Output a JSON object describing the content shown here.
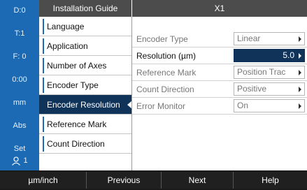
{
  "status": {
    "datum": "D:0",
    "tool": "T:1",
    "feed": "F:  0",
    "time": "0:00",
    "units": "mm",
    "mode": "Abs",
    "set": "Set",
    "user_count": "1",
    "user_icon": "user-icon"
  },
  "header": {
    "left_title": "Installation Guide",
    "right_title": "X1"
  },
  "menu": {
    "items": [
      {
        "label": "Language"
      },
      {
        "label": "Application"
      },
      {
        "label": "Number of Axes"
      },
      {
        "label": "Encoder Type"
      },
      {
        "label": "Encoder Resolution"
      },
      {
        "label": "Reference Mark"
      },
      {
        "label": "Count Direction"
      }
    ],
    "selected": "Encoder Resolution"
  },
  "form": {
    "rows": [
      {
        "label": "Encoder Type",
        "value": "Linear"
      },
      {
        "label": "Resolution (µm)",
        "value": "5.0"
      },
      {
        "label": "Reference Mark",
        "value": "Position Trac"
      },
      {
        "label": "Count Direction",
        "value": "Positive"
      },
      {
        "label": "Error Monitor",
        "value": "On"
      }
    ],
    "active_row": "Resolution (µm)"
  },
  "softkeys": {
    "units": "µm/inch",
    "previous": "Previous",
    "next": "Next",
    "help": "Help"
  },
  "colors": {
    "status_bar": "#1b6ab3",
    "header": "#4c4c4c",
    "selected": "#10335a",
    "softkey_bar": "#1a1a1a"
  }
}
